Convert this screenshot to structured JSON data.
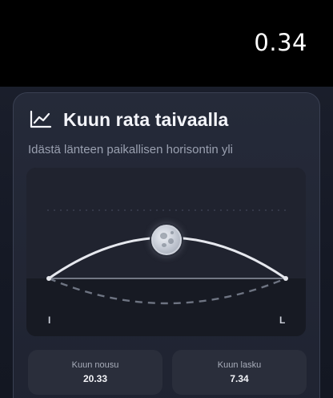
{
  "status_bar": {
    "time": "0.34"
  },
  "card": {
    "icon": "line-chart-icon",
    "title": "Kuun rata taivaalla",
    "subtitle": "Idästä länteen paikallisen horisontin yli"
  },
  "moon_path": {
    "east_label": "I",
    "west_label": "L"
  },
  "moonrise": {
    "label": "Kuun nousu",
    "value": "20.33"
  },
  "moonset": {
    "label": "Kuun lasku",
    "value": "7.34"
  }
}
